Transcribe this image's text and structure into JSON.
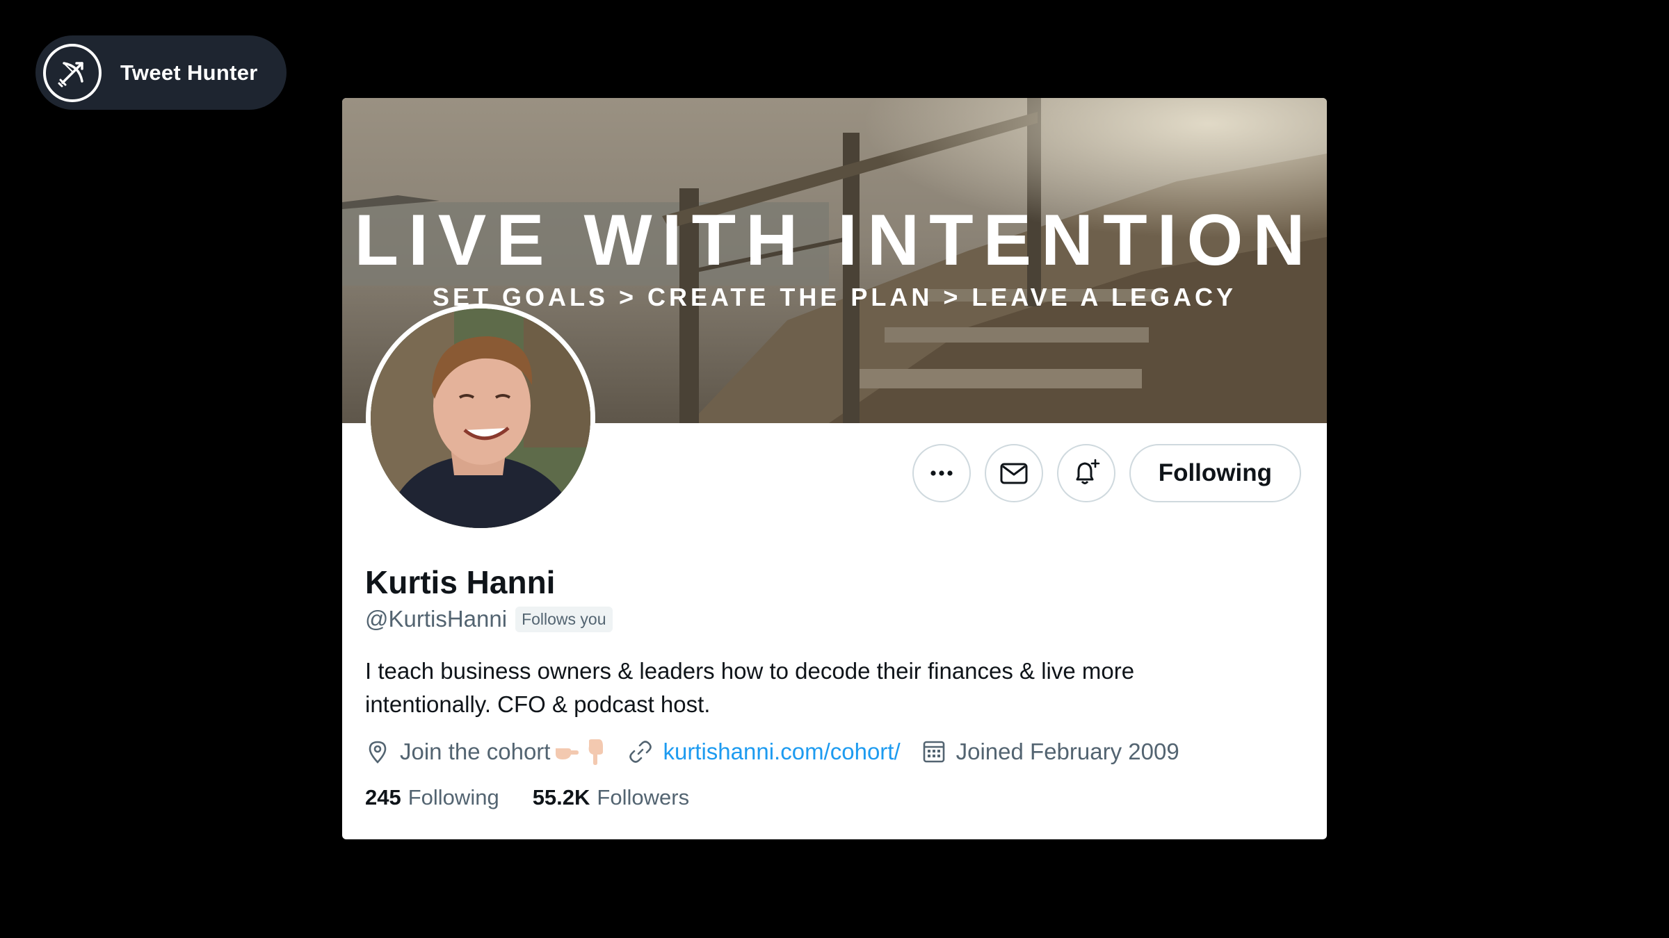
{
  "brand": {
    "name": "Tweet Hunter",
    "logo_icon": "bow-arrow-icon"
  },
  "banner": {
    "headline": "LIVE WITH INTENTION",
    "tagline": "SET GOALS > CREATE THE PLAN > LEAVE A LEGACY"
  },
  "profile": {
    "display_name": "Kurtis Hanni",
    "handle": "@KurtisHanni",
    "follows_you": "Follows you",
    "bio_line1": "I teach business owners & leaders how to decode their finances & live more",
    "bio_line2": "intentionally. CFO & podcast host.",
    "location": "Join the cohort",
    "website": "kurtishanni.com/cohort/",
    "joined": "Joined February 2009",
    "following_count": "245",
    "following_label": "Following",
    "followers_count": "55.2K",
    "followers_label": "Followers"
  },
  "actions": {
    "more_icon": "more-icon",
    "message_icon": "mail-icon",
    "notify_icon": "bell-plus-icon",
    "follow_label": "Following"
  },
  "colors": {
    "background": "#000000",
    "accent": "#1d9bf0",
    "text_primary": "#0f1419",
    "text_secondary": "#536471"
  }
}
